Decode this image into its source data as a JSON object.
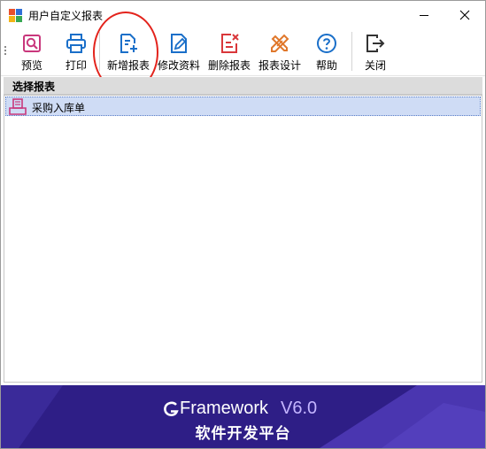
{
  "window": {
    "title": "用户自定义报表"
  },
  "toolbar": {
    "preview": "预览",
    "print": "打印",
    "new_report": "新增报表",
    "edit_info": "修改资料",
    "delete_report": "删除报表",
    "design_report": "报表设计",
    "help": "帮助",
    "close": "关闭"
  },
  "panel": {
    "header": "选择报表"
  },
  "reports": [
    {
      "name": "采购入库单",
      "selected": true
    }
  ],
  "banner": {
    "brand": "Framework",
    "version": "V6.0",
    "tagline": "软件开发平台"
  },
  "colors": {
    "accent": "#1a6fc9",
    "danger": "#d9373a",
    "warning": "#e0782c",
    "selection": "#cfdcf5",
    "banner": "#2e1e86"
  }
}
